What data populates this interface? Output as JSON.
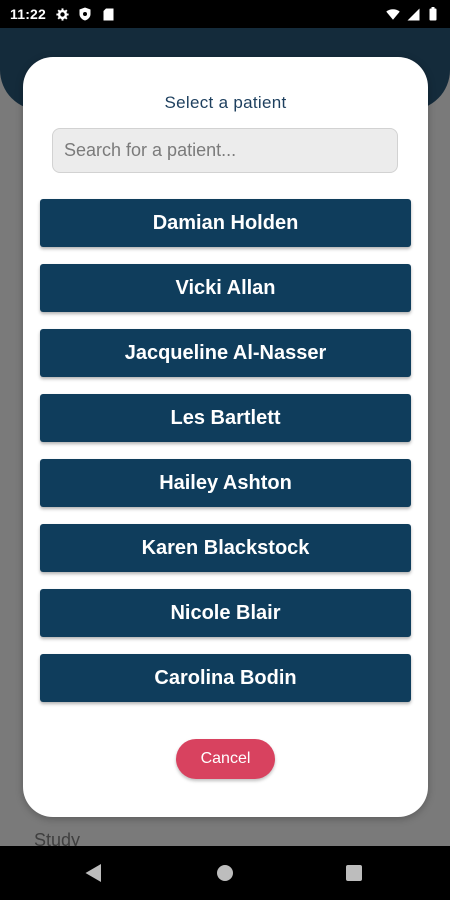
{
  "status_bar": {
    "time": "11:22",
    "left_icons": [
      "gear-icon",
      "shield-icon",
      "sd-card-icon"
    ],
    "right_icons": [
      "wifi-icon",
      "signal-icon",
      "battery-icon"
    ]
  },
  "background": {
    "partial_label": "Study"
  },
  "dialog": {
    "title": "Select a patient",
    "search": {
      "placeholder": "Search for a patient...",
      "value": ""
    },
    "patients": [
      "Damian Holden",
      "Vicki Allan",
      "Jacqueline Al-Nasser",
      "Les Bartlett",
      "Hailey Ashton",
      "Karen Blackstock",
      "Nicole Blair",
      "Carolina Bodin"
    ],
    "cancel_label": "Cancel"
  },
  "nav_bar": {
    "icons": [
      "back-icon",
      "home-icon",
      "recents-icon"
    ]
  },
  "colors": {
    "primary": "#0f3d5c",
    "cancel": "#d8425f",
    "title": "#1d3f5e"
  }
}
